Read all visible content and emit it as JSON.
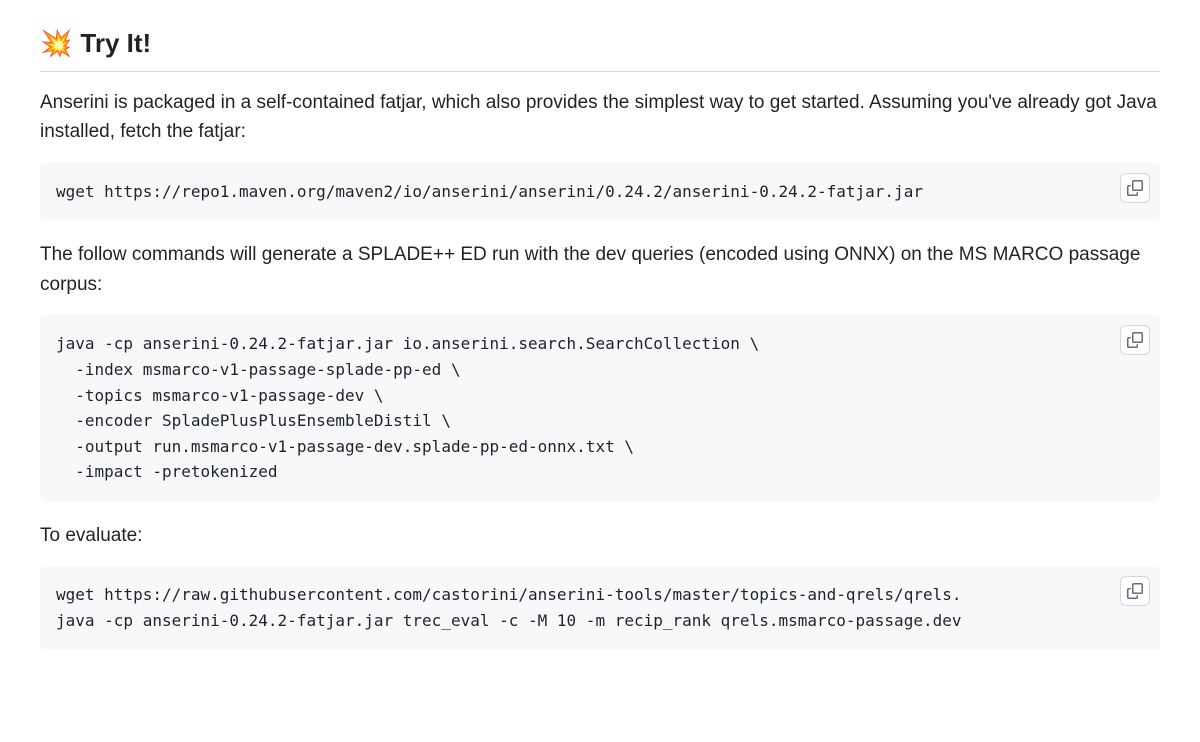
{
  "heading": {
    "emoji": "💥",
    "text": "Try It!"
  },
  "paragraphs": {
    "intro": "Anserini is packaged in a self-contained fatjar, which also provides the simplest way to get started. Assuming you've already got Java installed, fetch the fatjar:",
    "splade": "The follow commands will generate a SPLADE++ ED run with the dev queries (encoded using ONNX) on the MS MARCO passage corpus:",
    "evaluate": "To evaluate:"
  },
  "code": {
    "wget": "wget https://repo1.maven.org/maven2/io/anserini/anserini/0.24.2/anserini-0.24.2-fatjar.jar",
    "java": "java -cp anserini-0.24.2-fatjar.jar io.anserini.search.SearchCollection \\\n  -index msmarco-v1-passage-splade-pp-ed \\\n  -topics msmarco-v1-passage-dev \\\n  -encoder SpladePlusPlusEnsembleDistil \\\n  -output run.msmarco-v1-passage-dev.splade-pp-ed-onnx.txt \\\n  -impact -pretokenized",
    "eval": "wget https://raw.githubusercontent.com/castorini/anserini-tools/master/topics-and-qrels/qrels.\njava -cp anserini-0.24.2-fatjar.jar trec_eval -c -M 10 -m recip_rank qrels.msmarco-passage.dev"
  }
}
